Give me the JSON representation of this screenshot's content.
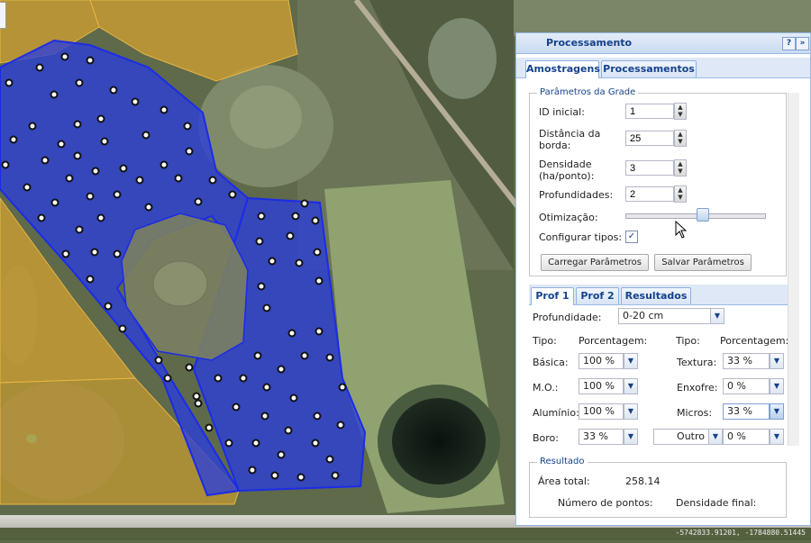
{
  "map": {
    "coords": "-5742833.91201, -1784880.51445"
  },
  "panel": {
    "title": "Processamento",
    "help_icon": "?",
    "collapse_icon": "»",
    "tabs": [
      "Amostragens",
      "Processamentos"
    ],
    "grid": {
      "legend": "Parâmetros da Grade",
      "id_label": "ID inicial:",
      "id_value": "1",
      "dist_label_1": "Distância da",
      "dist_label_2": "borda:",
      "dist_value": "25",
      "dens_label_1": "Densidade",
      "dens_label_2": "(ha/ponto):",
      "dens_value": "3",
      "prof_label": "Profundidades:",
      "prof_value": "2",
      "otim_label": "Otimização:",
      "otim_level": 0.55,
      "config_label": "Configurar tipos:",
      "config_checked": true,
      "load_btn": "Carregar Parâmetros",
      "save_btn": "Salvar Parâmetros"
    },
    "subtabs": [
      "Prof 1",
      "Prof 2",
      "Resultados"
    ],
    "prof": {
      "depth_label": "Profundidade:",
      "depth_value": "0-20 cm",
      "tipo_h1": "Tipo:",
      "pct_h1": "Porcentagem:",
      "tipo_h2": "Tipo:",
      "pct_h2": "Porcentagem:",
      "rows_left": [
        {
          "label": "Básica:",
          "value": "100 %"
        },
        {
          "label": "M.O.:",
          "value": "100 %"
        },
        {
          "label": "Alumínio:",
          "value": "100 %"
        },
        {
          "label": "Boro:",
          "value": "33 %"
        }
      ],
      "rows_right": [
        {
          "label": "Textura:",
          "value": "33 %"
        },
        {
          "label": "Enxofre:",
          "value": "0 %"
        },
        {
          "label": "Micros:",
          "value": "33 %"
        }
      ],
      "outro_value": "Outro",
      "outro_pct": "0 %"
    },
    "result": {
      "legend": "Resultado",
      "area_label": "Área total:",
      "area_value": "258.14",
      "points_label": "Número de pontos:",
      "density_label": "Densidade final:"
    }
  }
}
